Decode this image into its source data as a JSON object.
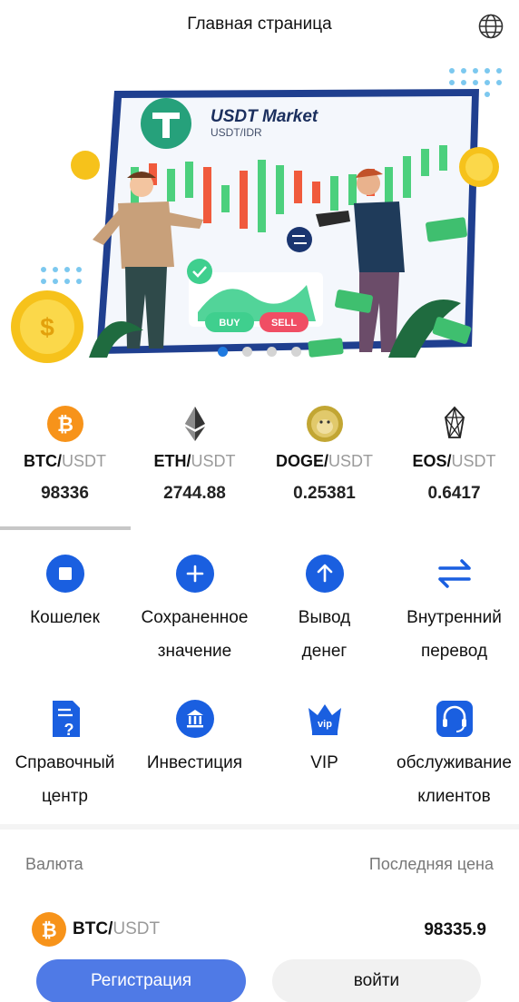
{
  "header": {
    "title": "Главная страница",
    "globe_icon": "globe-icon"
  },
  "banner": {
    "title": "USDT Market",
    "subtitle": "USDT/IDR",
    "buy_label": "BUY",
    "sell_label": "SELL",
    "slide_count": 4,
    "active_slide": 1
  },
  "tickers": [
    {
      "base": "BTC",
      "sep": "/",
      "quote": "USDT",
      "price": "98336",
      "icon": "bitcoin-icon"
    },
    {
      "base": "ETH",
      "sep": "/",
      "quote": "USDT",
      "price": "2744.88",
      "icon": "ethereum-icon"
    },
    {
      "base": "DOGE",
      "sep": "/",
      "quote": "USDT",
      "price": "0.25381",
      "icon": "dogecoin-icon"
    },
    {
      "base": "EOS",
      "sep": "/",
      "quote": "USDT",
      "price": "0.6417",
      "icon": "eos-icon"
    }
  ],
  "menu": [
    {
      "label": "Кошелек",
      "icon": "wallet-icon"
    },
    {
      "label": "Сохраненное\nзначение",
      "icon": "plus-icon"
    },
    {
      "label": "Вывод\nденег",
      "icon": "withdraw-arrow-icon"
    },
    {
      "label": "Внутренний\nперевод",
      "icon": "transfer-arrows-icon"
    },
    {
      "label": "Справочный\nцентр",
      "icon": "help-document-icon"
    },
    {
      "label": "Инвестиция",
      "icon": "bank-icon"
    },
    {
      "label": "VIP",
      "icon": "vip-crown-icon"
    },
    {
      "label": "обслуживание\nклиентов",
      "icon": "headset-icon"
    }
  ],
  "market": {
    "col_currency": "Валюта",
    "col_last_price": "Последняя цена",
    "rows": [
      {
        "base": "BTC",
        "sep": "/",
        "quote": "USDT",
        "price": "98335.9",
        "icon": "bitcoin-icon"
      }
    ]
  },
  "buttons": {
    "register": "Регистрация",
    "login": "войти"
  },
  "colors": {
    "accent": "#1f7ae0",
    "register_bg": "#4f7ae6",
    "btc_orange": "#f7931a"
  }
}
